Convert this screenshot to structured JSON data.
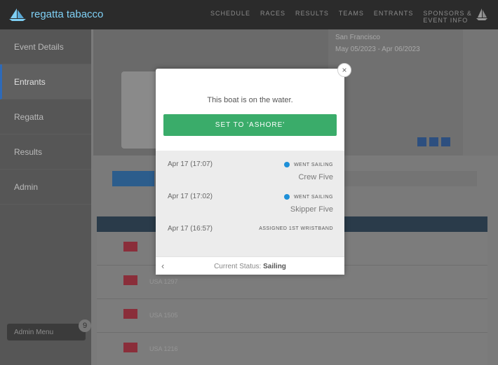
{
  "app": {
    "brand": "regatta tabacco"
  },
  "nav": {
    "items": [
      "SCHEDULE",
      "RACES",
      "RESULTS",
      "TEAMS",
      "ENTRANTS",
      "SPONSORS & EVENT INFO"
    ]
  },
  "sidebar": {
    "items": [
      {
        "label": "Event Details"
      },
      {
        "label": "Entrants"
      },
      {
        "label": "Regatta"
      },
      {
        "label": "Results"
      },
      {
        "label": "Admin"
      }
    ],
    "admin_menu": "Admin Menu",
    "admin_badge": "9"
  },
  "info": {
    "line1": "San Francisco",
    "line2": "May 05/2023 - Apr 06/2023"
  },
  "rows": [
    {
      "text": ""
    },
    {
      "text": "USA 1297"
    },
    {
      "text": "USA 1505"
    },
    {
      "text": "USA 1216"
    }
  ],
  "modal": {
    "close": "×",
    "message": "This boat is on the water.",
    "button_label": "SET TO 'ASHORE'",
    "history": [
      {
        "date": "Apr 17 (17:07)",
        "event": "WENT SAILING",
        "name": "Crew Five",
        "dot": true
      },
      {
        "date": "Apr 17 (17:02)",
        "event": "WENT SAILING",
        "name": "Skipper Five",
        "dot": true
      },
      {
        "date": "Apr 17 (16:57)",
        "event": "ASSIGNED 1ST WRISTBAND",
        "name": "",
        "dot": false
      }
    ],
    "status_label": "Current Status:",
    "status_value": "Sailing",
    "back_icon": "‹"
  },
  "colors": {
    "accent_green": "#3aac6a",
    "dot_blue": "#1e90d8",
    "brand_blue": "#7fd0f5"
  }
}
